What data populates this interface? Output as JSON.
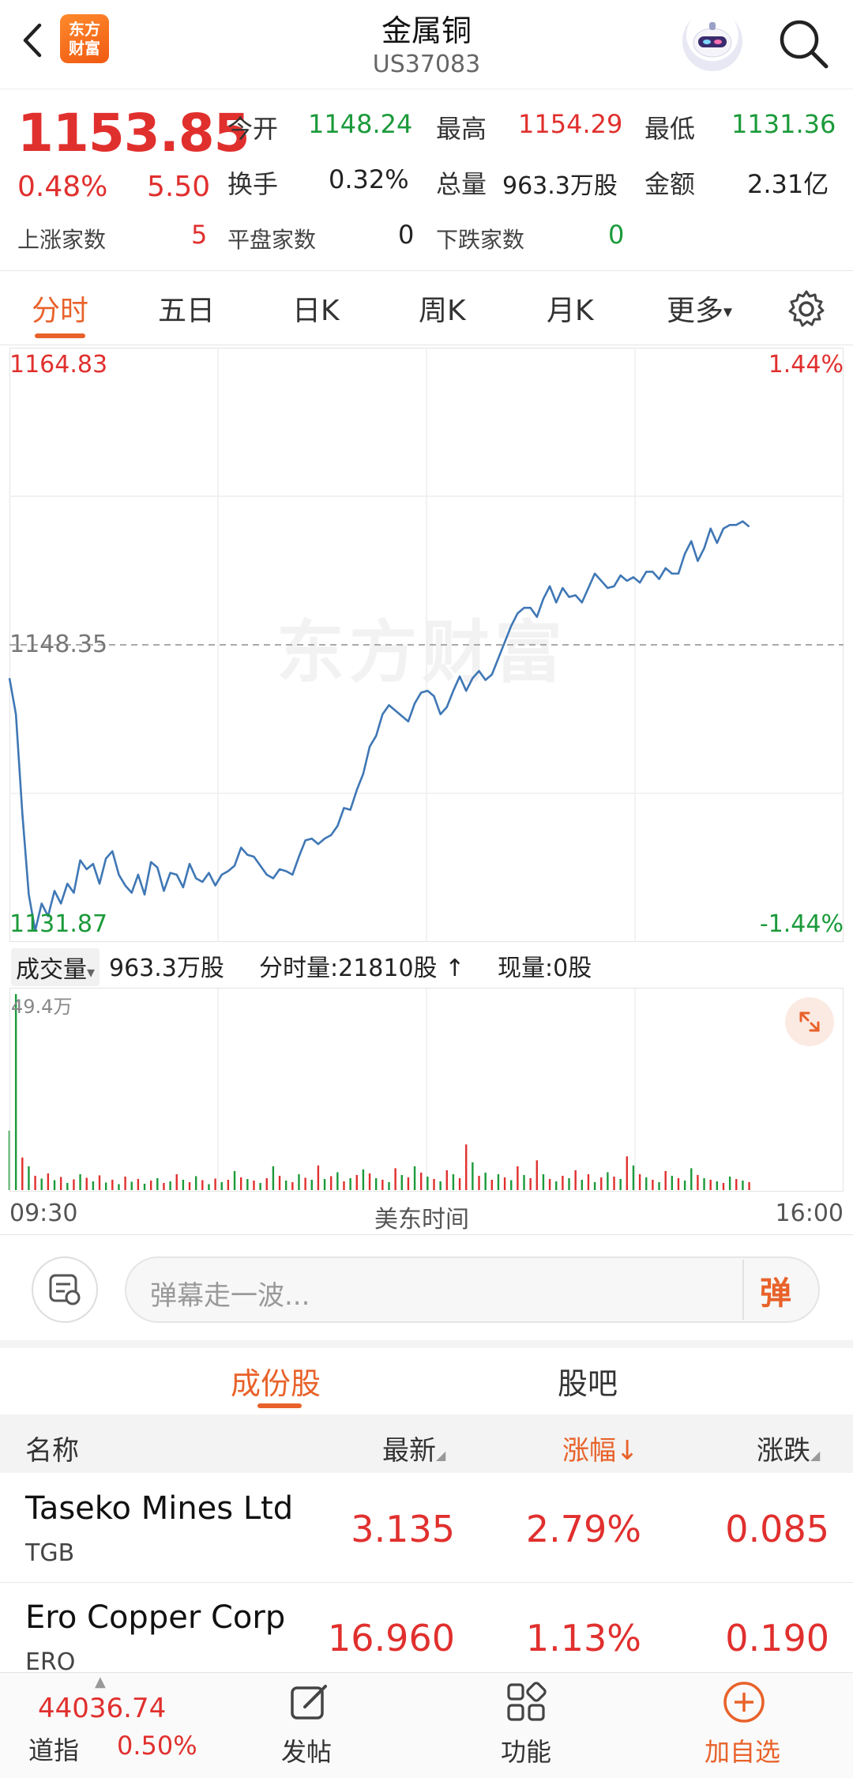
{
  "header": {
    "title": "金属铜",
    "code": "US37083",
    "logo_text_line1": "东方",
    "logo_text_line2": "财富"
  },
  "quote": {
    "price": "1153.85",
    "change_pct": "0.48%",
    "change": "5.50",
    "open_label": "今开",
    "open": "1148.24",
    "high_label": "最高",
    "high": "1154.29",
    "low_label": "最低",
    "low": "1131.36",
    "turnover_label": "换手",
    "turnover": "0.32%",
    "volume_label": "总量",
    "volume": "963.3万股",
    "amount_label": "金额",
    "amount": "2.31亿",
    "up_label": "上涨家数",
    "up": "5",
    "flat_label": "平盘家数",
    "flat": "0",
    "down_label": "下跌家数",
    "down": "0"
  },
  "tabs": [
    "分时",
    "五日",
    "日K",
    "周K",
    "月K",
    "更多"
  ],
  "chart": {
    "top_price": "1164.83",
    "mid_price": "1148.35",
    "bottom_price": "1131.87",
    "top_pct": "1.44%",
    "bottom_pct": "-1.44%",
    "watermark": "东方财富",
    "volume_selector": "成交量",
    "volume_total": "963.3万股",
    "minute_volume": "分时量:21810股",
    "current_volume": "现量:0股",
    "volume_max": "49.4万",
    "time_start": "09:30",
    "time_label": "美东时间",
    "time_end": "16:00"
  },
  "chart_data": {
    "type": "line",
    "y_range": [
      1131.87,
      1164.83
    ],
    "prev_close": 1148.35,
    "x_range": [
      "09:30",
      "16:00"
    ],
    "y_percent_range": [
      "-1.44%",
      "1.44%"
    ],
    "price_series": [
      1146.5,
      1144.5,
      1139.0,
      1134.5,
      1132.5,
      1134.0,
      1133.3,
      1134.7,
      1134.0,
      1135.1,
      1134.6,
      1136.4,
      1135.9,
      1136.2,
      1135.1,
      1136.5,
      1136.9,
      1135.6,
      1135.0,
      1134.6,
      1135.6,
      1134.5,
      1136.3,
      1136.0,
      1134.7,
      1135.7,
      1135.6,
      1134.9,
      1136.2,
      1135.4,
      1135.2,
      1135.7,
      1135.0,
      1135.6,
      1135.8,
      1136.1,
      1137.1,
      1136.7,
      1136.6,
      1136.1,
      1135.6,
      1135.4,
      1135.9,
      1135.8,
      1135.6,
      1136.6,
      1137.5,
      1137.6,
      1137.3,
      1137.6,
      1137.8,
      1138.3,
      1139.3,
      1139.2,
      1140.3,
      1141.2,
      1142.7,
      1143.3,
      1144.5,
      1145.0,
      1144.7,
      1144.4,
      1144.1,
      1145.1,
      1145.7,
      1145.8,
      1145.5,
      1144.5,
      1144.9,
      1145.8,
      1146.6,
      1145.8,
      1146.5,
      1146.9,
      1146.4,
      1146.7,
      1147.6,
      1148.5,
      1149.4,
      1150.1,
      1150.4,
      1150.4,
      1149.9,
      1150.9,
      1151.6,
      1150.7,
      1151.5,
      1151.0,
      1151.1,
      1150.7,
      1151.5,
      1152.3,
      1151.9,
      1151.5,
      1151.6,
      1152.2,
      1151.9,
      1152.1,
      1151.8,
      1152.4,
      1152.4,
      1152.0,
      1152.6,
      1152.3,
      1152.3,
      1153.4,
      1154.1,
      1153.0,
      1153.7,
      1154.8,
      1154.0,
      1154.8,
      1155.0,
      1155.0,
      1155.2,
      1154.9
    ],
    "volume_series": [
      {
        "v": 150000,
        "up": false
      },
      {
        "v": 494000,
        "up": false
      },
      {
        "v": 82000,
        "up": true
      },
      {
        "v": 60000,
        "up": false
      },
      {
        "v": 36000,
        "up": true
      },
      {
        "v": 29000,
        "up": false
      },
      {
        "v": 42000,
        "up": true
      },
      {
        "v": 25000,
        "up": false
      },
      {
        "v": 33000,
        "up": true
      },
      {
        "v": 18000,
        "up": false
      },
      {
        "v": 27000,
        "up": true
      },
      {
        "v": 40000,
        "up": false
      },
      {
        "v": 31000,
        "up": true
      },
      {
        "v": 22000,
        "up": false
      },
      {
        "v": 37000,
        "up": true
      },
      {
        "v": 19000,
        "up": false
      },
      {
        "v": 26000,
        "up": true
      },
      {
        "v": 15000,
        "up": false
      },
      {
        "v": 34000,
        "up": true
      },
      {
        "v": 21000,
        "up": false
      },
      {
        "v": 28000,
        "up": true
      },
      {
        "v": 16000,
        "up": false
      },
      {
        "v": 24000,
        "up": true
      },
      {
        "v": 30000,
        "up": false
      },
      {
        "v": 18000,
        "up": true
      },
      {
        "v": 22000,
        "up": false
      },
      {
        "v": 40000,
        "up": true
      },
      {
        "v": 26000,
        "up": false
      },
      {
        "v": 20000,
        "up": true
      },
      {
        "v": 35000,
        "up": false
      },
      {
        "v": 25000,
        "up": true
      },
      {
        "v": 15000,
        "up": false
      },
      {
        "v": 29000,
        "up": true
      },
      {
        "v": 20000,
        "up": false
      },
      {
        "v": 26000,
        "up": true
      },
      {
        "v": 48000,
        "up": false
      },
      {
        "v": 32000,
        "up": true
      },
      {
        "v": 28000,
        "up": false
      },
      {
        "v": 24000,
        "up": true
      },
      {
        "v": 18000,
        "up": false
      },
      {
        "v": 30000,
        "up": true
      },
      {
        "v": 60000,
        "up": false
      },
      {
        "v": 36000,
        "up": true
      },
      {
        "v": 24000,
        "up": false
      },
      {
        "v": 20000,
        "up": true
      },
      {
        "v": 40000,
        "up": false
      },
      {
        "v": 31000,
        "up": true
      },
      {
        "v": 26000,
        "up": false
      },
      {
        "v": 62000,
        "up": true
      },
      {
        "v": 28000,
        "up": false
      },
      {
        "v": 35000,
        "up": true
      },
      {
        "v": 45000,
        "up": false
      },
      {
        "v": 22000,
        "up": true
      },
      {
        "v": 30000,
        "up": false
      },
      {
        "v": 38000,
        "up": true
      },
      {
        "v": 52000,
        "up": false
      },
      {
        "v": 42000,
        "up": true
      },
      {
        "v": 30000,
        "up": false
      },
      {
        "v": 26000,
        "up": true
      },
      {
        "v": 20000,
        "up": false
      },
      {
        "v": 55000,
        "up": true
      },
      {
        "v": 38000,
        "up": false
      },
      {
        "v": 32000,
        "up": true
      },
      {
        "v": 60000,
        "up": false
      },
      {
        "v": 44000,
        "up": true
      },
      {
        "v": 34000,
        "up": false
      },
      {
        "v": 28000,
        "up": true
      },
      {
        "v": 22000,
        "up": false
      },
      {
        "v": 50000,
        "up": true
      },
      {
        "v": 40000,
        "up": false
      },
      {
        "v": 30000,
        "up": true
      },
      {
        "v": 115000,
        "up": true
      },
      {
        "v": 70000,
        "up": false
      },
      {
        "v": 36000,
        "up": true
      },
      {
        "v": 44000,
        "up": false
      },
      {
        "v": 26000,
        "up": true
      },
      {
        "v": 40000,
        "up": false
      },
      {
        "v": 32000,
        "up": true
      },
      {
        "v": 25000,
        "up": false
      },
      {
        "v": 60000,
        "up": true
      },
      {
        "v": 38000,
        "up": false
      },
      {
        "v": 30000,
        "up": true
      },
      {
        "v": 75000,
        "up": true
      },
      {
        "v": 40000,
        "up": false
      },
      {
        "v": 28000,
        "up": true
      },
      {
        "v": 22000,
        "up": false
      },
      {
        "v": 36000,
        "up": true
      },
      {
        "v": 30000,
        "up": false
      },
      {
        "v": 50000,
        "up": true
      },
      {
        "v": 26000,
        "up": false
      },
      {
        "v": 40000,
        "up": true
      },
      {
        "v": 20000,
        "up": false
      },
      {
        "v": 32000,
        "up": true
      },
      {
        "v": 45000,
        "up": false
      },
      {
        "v": 34000,
        "up": true
      },
      {
        "v": 28000,
        "up": false
      },
      {
        "v": 85000,
        "up": true
      },
      {
        "v": 62000,
        "up": false
      },
      {
        "v": 40000,
        "up": true
      },
      {
        "v": 32000,
        "up": false
      },
      {
        "v": 26000,
        "up": true
      },
      {
        "v": 20000,
        "up": false
      },
      {
        "v": 48000,
        "up": true
      },
      {
        "v": 36000,
        "up": false
      },
      {
        "v": 30000,
        "up": true
      },
      {
        "v": 24000,
        "up": false
      },
      {
        "v": 55000,
        "up": false
      },
      {
        "v": 38000,
        "up": true
      },
      {
        "v": 30000,
        "up": false
      },
      {
        "v": 26000,
        "up": true
      },
      {
        "v": 22000,
        "up": false
      },
      {
        "v": 18000,
        "up": true
      },
      {
        "v": 34000,
        "up": false
      },
      {
        "v": 28000,
        "up": true
      },
      {
        "v": 24000,
        "up": false
      },
      {
        "v": 20000,
        "up": true
      }
    ],
    "series_points": 390
  },
  "danmaku": {
    "placeholder": "弹幕走一波...",
    "button": "弹"
  },
  "components": {
    "tabs": [
      "成份股",
      "股吧"
    ],
    "headers": {
      "name": "名称",
      "last": "最新",
      "change_pct": "涨幅",
      "change": "涨跌"
    },
    "rows": [
      {
        "name": "Taseko Mines Ltd",
        "code": "TGB",
        "last": "3.135",
        "change_pct": "2.79%",
        "change": "0.085"
      },
      {
        "name": "Ero Copper Corp",
        "code": "ERO",
        "last": "16.960",
        "change_pct": "1.13%",
        "change": "0.190"
      }
    ]
  },
  "bottom": {
    "index_value": "44036.74",
    "index_name": "道指",
    "index_pct": "0.50%",
    "post": "发帖",
    "function": "功能",
    "add_watch": "加自选"
  },
  "colors": {
    "up": "#e0302e",
    "down": "#1b9a3a",
    "accent": "#e8622a",
    "line": "#3f77b5"
  }
}
